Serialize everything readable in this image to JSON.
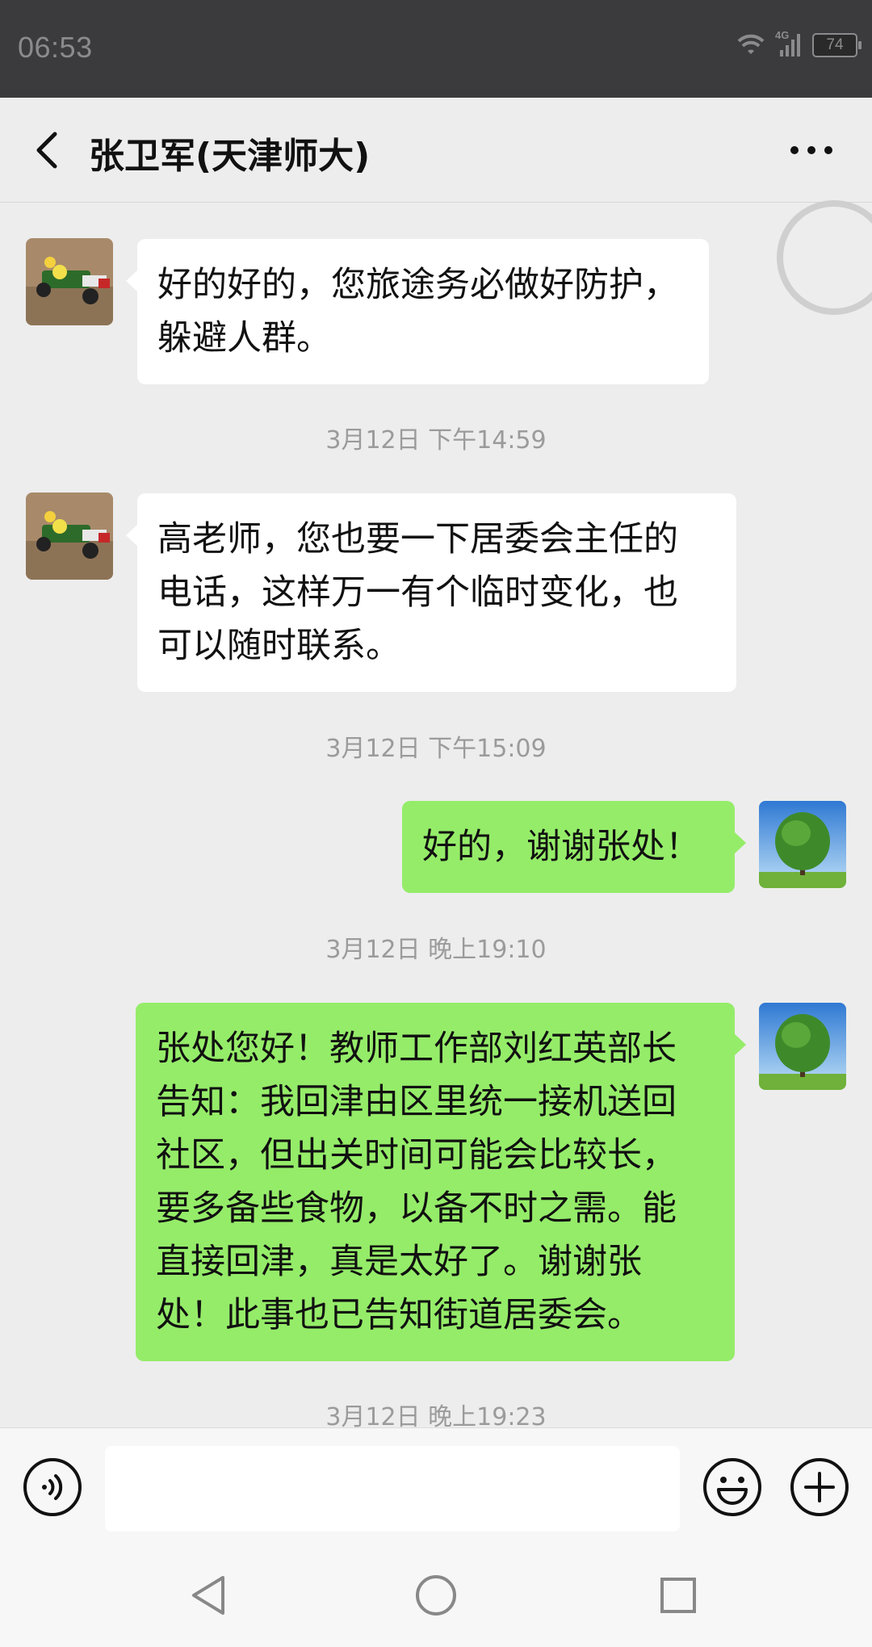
{
  "status_bar": {
    "time": "06:53",
    "network": "4G",
    "battery": "74"
  },
  "header": {
    "title": "张卫军(天津师大)",
    "back_icon": "chevron-left-icon",
    "more_icon": "ellipsis-icon"
  },
  "messages": [
    {
      "type": "message",
      "side": "left",
      "lines": [
        "好的好的，您旅途务必做好防护，",
        "躲避人群。"
      ]
    },
    {
      "type": "timestamp",
      "text": "3月12日 下午14:59"
    },
    {
      "type": "message",
      "side": "left",
      "lines": [
        "高老师，您也要一下居委会主任的",
        "电话，这样万一有个临时变化，也",
        "可以随时联系。"
      ]
    },
    {
      "type": "timestamp",
      "text": "3月12日 下午15:09"
    },
    {
      "type": "message",
      "side": "right",
      "lines": [
        "好的，谢谢张处！"
      ]
    },
    {
      "type": "timestamp",
      "text": "3月12日 晚上19:10"
    },
    {
      "type": "message",
      "side": "right",
      "lines": [
        "张处您好！教师工作部刘红英部长",
        "告知：我回津由区里统一接机送回",
        "社区，但出关时间可能会比较长，",
        "要多备些食物，以备不时之需。能",
        "直接回津，真是太好了。谢谢张",
        "处！此事也已告知街道居委会。"
      ]
    },
    {
      "type": "timestamp",
      "text": "3月12日 晚上19:23"
    }
  ],
  "input_bar": {
    "voice_icon": "voice-icon",
    "input_value": "",
    "emoji_icon": "emoji-icon",
    "plus_icon": "plus-icon"
  },
  "system_nav": [
    "back-triangle-icon",
    "home-circle-icon",
    "recents-square-icon"
  ],
  "colors": {
    "sent_bubble": "#95ec69",
    "received_bubble": "#ffffff",
    "background": "#ededed",
    "status_bar": "#3b3b3d"
  }
}
